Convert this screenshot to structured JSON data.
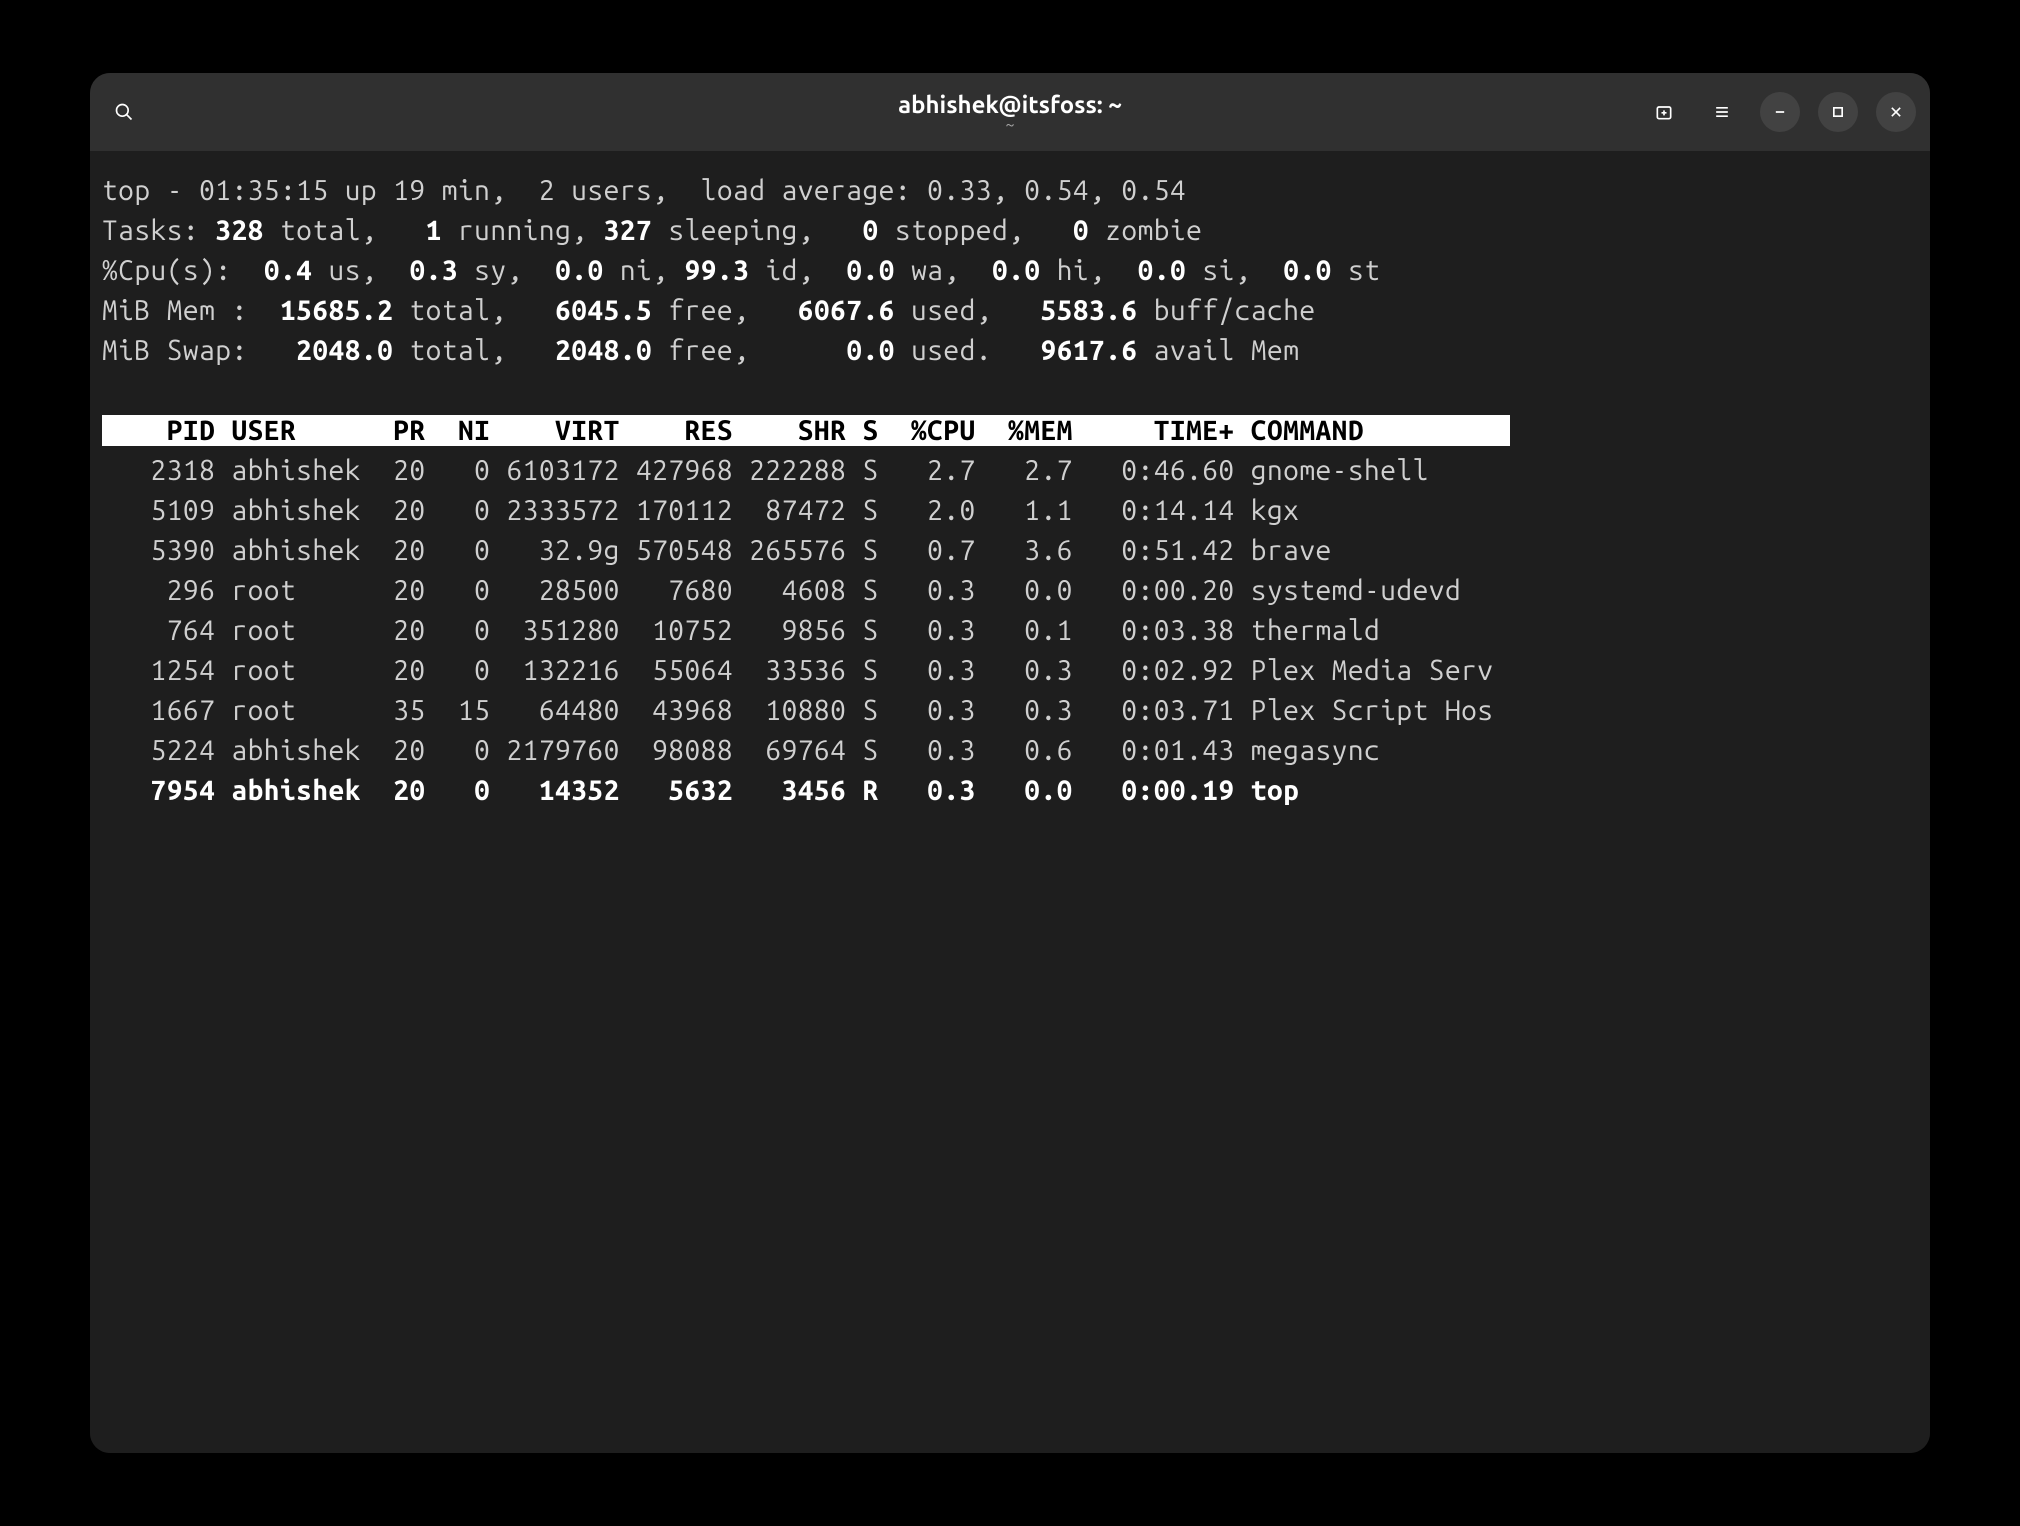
{
  "window": {
    "title": "abhishek@itsfoss: ~",
    "subtitle": "~"
  },
  "summary": {
    "line1_pre": "top - 01:35:15 up 19 min,  2 users,  load average: 0.33, 0.54, 0.54",
    "tasks": {
      "label": "Tasks: ",
      "total": "328",
      "total_suf": " total,   ",
      "running": "1",
      "running_suf": " running, ",
      "sleeping": "327",
      "sleeping_suf": " sleeping,   ",
      "stopped": "0",
      "stopped_suf": " stopped,   ",
      "zombie": "0",
      "zombie_suf": " zombie"
    },
    "cpu": {
      "label": "%Cpu(s):  ",
      "us": "0.4",
      "us_suf": " us,  ",
      "sy": "0.3",
      "sy_suf": " sy,  ",
      "ni": "0.0",
      "ni_suf": " ni, ",
      "id": "99.3",
      "id_suf": " id,  ",
      "wa": "0.0",
      "wa_suf": " wa,  ",
      "hi": "0.0",
      "hi_suf": " hi,  ",
      "si": "0.0",
      "si_suf": " si,  ",
      "st": "0.0",
      "st_suf": " st"
    },
    "mem": {
      "label": "MiB Mem :  ",
      "total": "15685.2",
      "total_suf": " total,   ",
      "free": "6045.5",
      "free_suf": " free,   ",
      "used": "6067.6",
      "used_suf": " used,   ",
      "buff": "5583.6",
      "buff_suf": " buff/cache"
    },
    "swap": {
      "label": "MiB Swap:   ",
      "total": "2048.0",
      "total_suf": " total,   ",
      "free": "2048.0",
      "free_suf": " free,      ",
      "used": "0.0",
      "used_suf": " used.   ",
      "avail": "9617.6",
      "avail_suf": " avail Mem"
    }
  },
  "columns": "    PID USER      PR  NI    VIRT    RES    SHR S  %CPU  %MEM     TIME+ COMMAND         ",
  "processes": [
    {
      "pid": "2318",
      "user": "abhishek",
      "pr": "20",
      "ni": "0",
      "virt": "6103172",
      "res": "427968",
      "shr": "222288",
      "s": "S",
      "cpu": "2.7",
      "mem": "2.7",
      "time": "0:46.60",
      "cmd": "gnome-shell",
      "bold": false
    },
    {
      "pid": "5109",
      "user": "abhishek",
      "pr": "20",
      "ni": "0",
      "virt": "2333572",
      "res": "170112",
      "shr": "87472",
      "s": "S",
      "cpu": "2.0",
      "mem": "1.1",
      "time": "0:14.14",
      "cmd": "kgx",
      "bold": false
    },
    {
      "pid": "5390",
      "user": "abhishek",
      "pr": "20",
      "ni": "0",
      "virt": "32.9g",
      "res": "570548",
      "shr": "265576",
      "s": "S",
      "cpu": "0.7",
      "mem": "3.6",
      "time": "0:51.42",
      "cmd": "brave",
      "bold": false
    },
    {
      "pid": "296",
      "user": "root",
      "pr": "20",
      "ni": "0",
      "virt": "28500",
      "res": "7680",
      "shr": "4608",
      "s": "S",
      "cpu": "0.3",
      "mem": "0.0",
      "time": "0:00.20",
      "cmd": "systemd-udevd",
      "bold": false
    },
    {
      "pid": "764",
      "user": "root",
      "pr": "20",
      "ni": "0",
      "virt": "351280",
      "res": "10752",
      "shr": "9856",
      "s": "S",
      "cpu": "0.3",
      "mem": "0.1",
      "time": "0:03.38",
      "cmd": "thermald",
      "bold": false
    },
    {
      "pid": "1254",
      "user": "root",
      "pr": "20",
      "ni": "0",
      "virt": "132216",
      "res": "55064",
      "shr": "33536",
      "s": "S",
      "cpu": "0.3",
      "mem": "0.3",
      "time": "0:02.92",
      "cmd": "Plex Media Serv",
      "bold": false
    },
    {
      "pid": "1667",
      "user": "root",
      "pr": "35",
      "ni": "15",
      "virt": "64480",
      "res": "43968",
      "shr": "10880",
      "s": "S",
      "cpu": "0.3",
      "mem": "0.3",
      "time": "0:03.71",
      "cmd": "Plex Script Hos",
      "bold": false
    },
    {
      "pid": "5224",
      "user": "abhishek",
      "pr": "20",
      "ni": "0",
      "virt": "2179760",
      "res": "98088",
      "shr": "69764",
      "s": "S",
      "cpu": "0.3",
      "mem": "0.6",
      "time": "0:01.43",
      "cmd": "megasync",
      "bold": false
    },
    {
      "pid": "7954",
      "user": "abhishek",
      "pr": "20",
      "ni": "0",
      "virt": "14352",
      "res": "5632",
      "shr": "3456",
      "s": "R",
      "cpu": "0.3",
      "mem": "0.0",
      "time": "0:00.19",
      "cmd": "top",
      "bold": true
    }
  ]
}
